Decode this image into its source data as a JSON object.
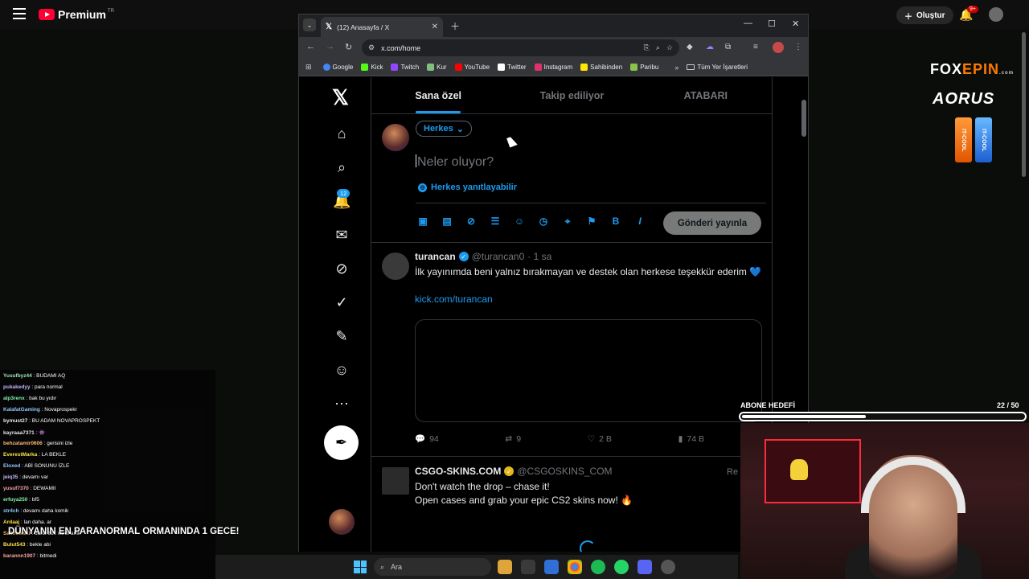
{
  "youtube": {
    "logo": "Premium",
    "region": "TR",
    "create_label": "Oluştur",
    "notif_count": "9+"
  },
  "sponsors": {
    "fox": [
      "FOX",
      "EPIN"
    ],
    "fox_sub": ".com",
    "aorus": "AORUS",
    "cans": [
      "IT-COOL",
      "IT-COOL"
    ]
  },
  "chrome": {
    "tab_title": "(12) Anasayfa / X",
    "url": "x.com/home",
    "bookmarks": [
      {
        "label": "Google",
        "color": "#4285f4"
      },
      {
        "label": "Kick",
        "color": "#53fc18"
      },
      {
        "label": "Twitch",
        "color": "#9146ff"
      },
      {
        "label": "Kur",
        "color": "#7fbf7f"
      },
      {
        "label": "YouTube",
        "color": "#ff0000"
      },
      {
        "label": "Twitter",
        "color": "#ffffff"
      },
      {
        "label": "Instagram",
        "color": "#e1306c"
      },
      {
        "label": "Sahibinden",
        "color": "#ffe800"
      },
      {
        "label": "Paribu",
        "color": "#8bc34a"
      }
    ],
    "bookmark_folder": "Tüm Yer İşaretleri"
  },
  "x": {
    "tabs": [
      "Sana özel",
      "Takip ediliyor",
      "ATABARI"
    ],
    "notif_badge": "12",
    "composer": {
      "audience": "Herkes",
      "placeholder": "Neler oluyor?",
      "reply_setting": "Herkes yanıtlayabilir",
      "publish": "Gönderi yayınla"
    },
    "tweets": [
      {
        "name": "turancan",
        "handle": "@turancan0",
        "time": "· 1 sa",
        "text": "İlk yayınımda beni yalnız bırakmayan ve destek olan herkese teşekkür ederim 💙",
        "link": "kick.com/turancan",
        "replies": "94",
        "retweets": "9",
        "likes": "2 B",
        "views": "74 B"
      },
      {
        "name": "CSGO-SKINS.COM",
        "handle": "@CSGOSKINS_COM",
        "more": "Re",
        "line1": "Don't watch the drop – chase it!",
        "line2": "Open cases and grab your epic CS2 skins now! 🔥"
      }
    ]
  },
  "chat": [
    {
      "user": "Yusufbyz44",
      "msg": ": BUDAMI AQ",
      "color": "#9ae6b4"
    },
    {
      "user": "pukakedyy",
      "msg": ": para normal",
      "color": "#c4b5fd"
    },
    {
      "user": "alp3renx",
      "msg": ": bak bu yıdır",
      "color": "#86efac"
    },
    {
      "user": "KalafatGaming",
      "msg": ": Novaprospekr",
      "color": "#93c5fd"
    },
    {
      "user": "bymust27",
      "msg": ": BU ADAM NOVAPROSPEKT",
      "color": "#e5e7eb"
    },
    {
      "user": "kayraaa7371",
      "msg": ": 👾",
      "color": "#e5e7eb"
    },
    {
      "user": "behzatamir0606",
      "msg": ": gerisini izle",
      "color": "#fdba74"
    },
    {
      "user": "EverestMarka",
      "msg": ": LA BEKLE",
      "color": "#fde047"
    },
    {
      "user": "Eloxed",
      "msg": ": ABİ SONUNU İZLE",
      "color": "#93c5fd"
    },
    {
      "user": "jeiq35",
      "msg": ": devamı var",
      "color": "#c4b5fd"
    },
    {
      "user": "yusuf7370",
      "msg": ": DEWAMII",
      "color": "#fca5a5"
    },
    {
      "user": "erfuya250",
      "msg": ": bf5",
      "color": "#86efac"
    },
    {
      "user": "str4ch",
      "msg": ": devamı daha komik",
      "color": "#93c5fd"
    },
    {
      "user": "Ardaaj",
      "msg": ": lan daha. ar",
      "color": "#fde047"
    },
    {
      "user": "Salihowski",
      "msg": ": daha 3dk vardı amk",
      "color": "#fdba74"
    },
    {
      "user": "Bulut543",
      "msg": ": bekle abi",
      "color": "#fde047"
    },
    {
      "user": "barannn1907",
      "msg": ": bitmedi",
      "color": "#fca5a5"
    }
  ],
  "banner": "DÜNYANIN EN PARANORMAL ORMANINDA 1 GECE!",
  "goal": {
    "label": "ABONE HEDEFİ",
    "count": "22 / 50",
    "fraction": 0.44
  },
  "taskbar": {
    "search": "Ara"
  }
}
